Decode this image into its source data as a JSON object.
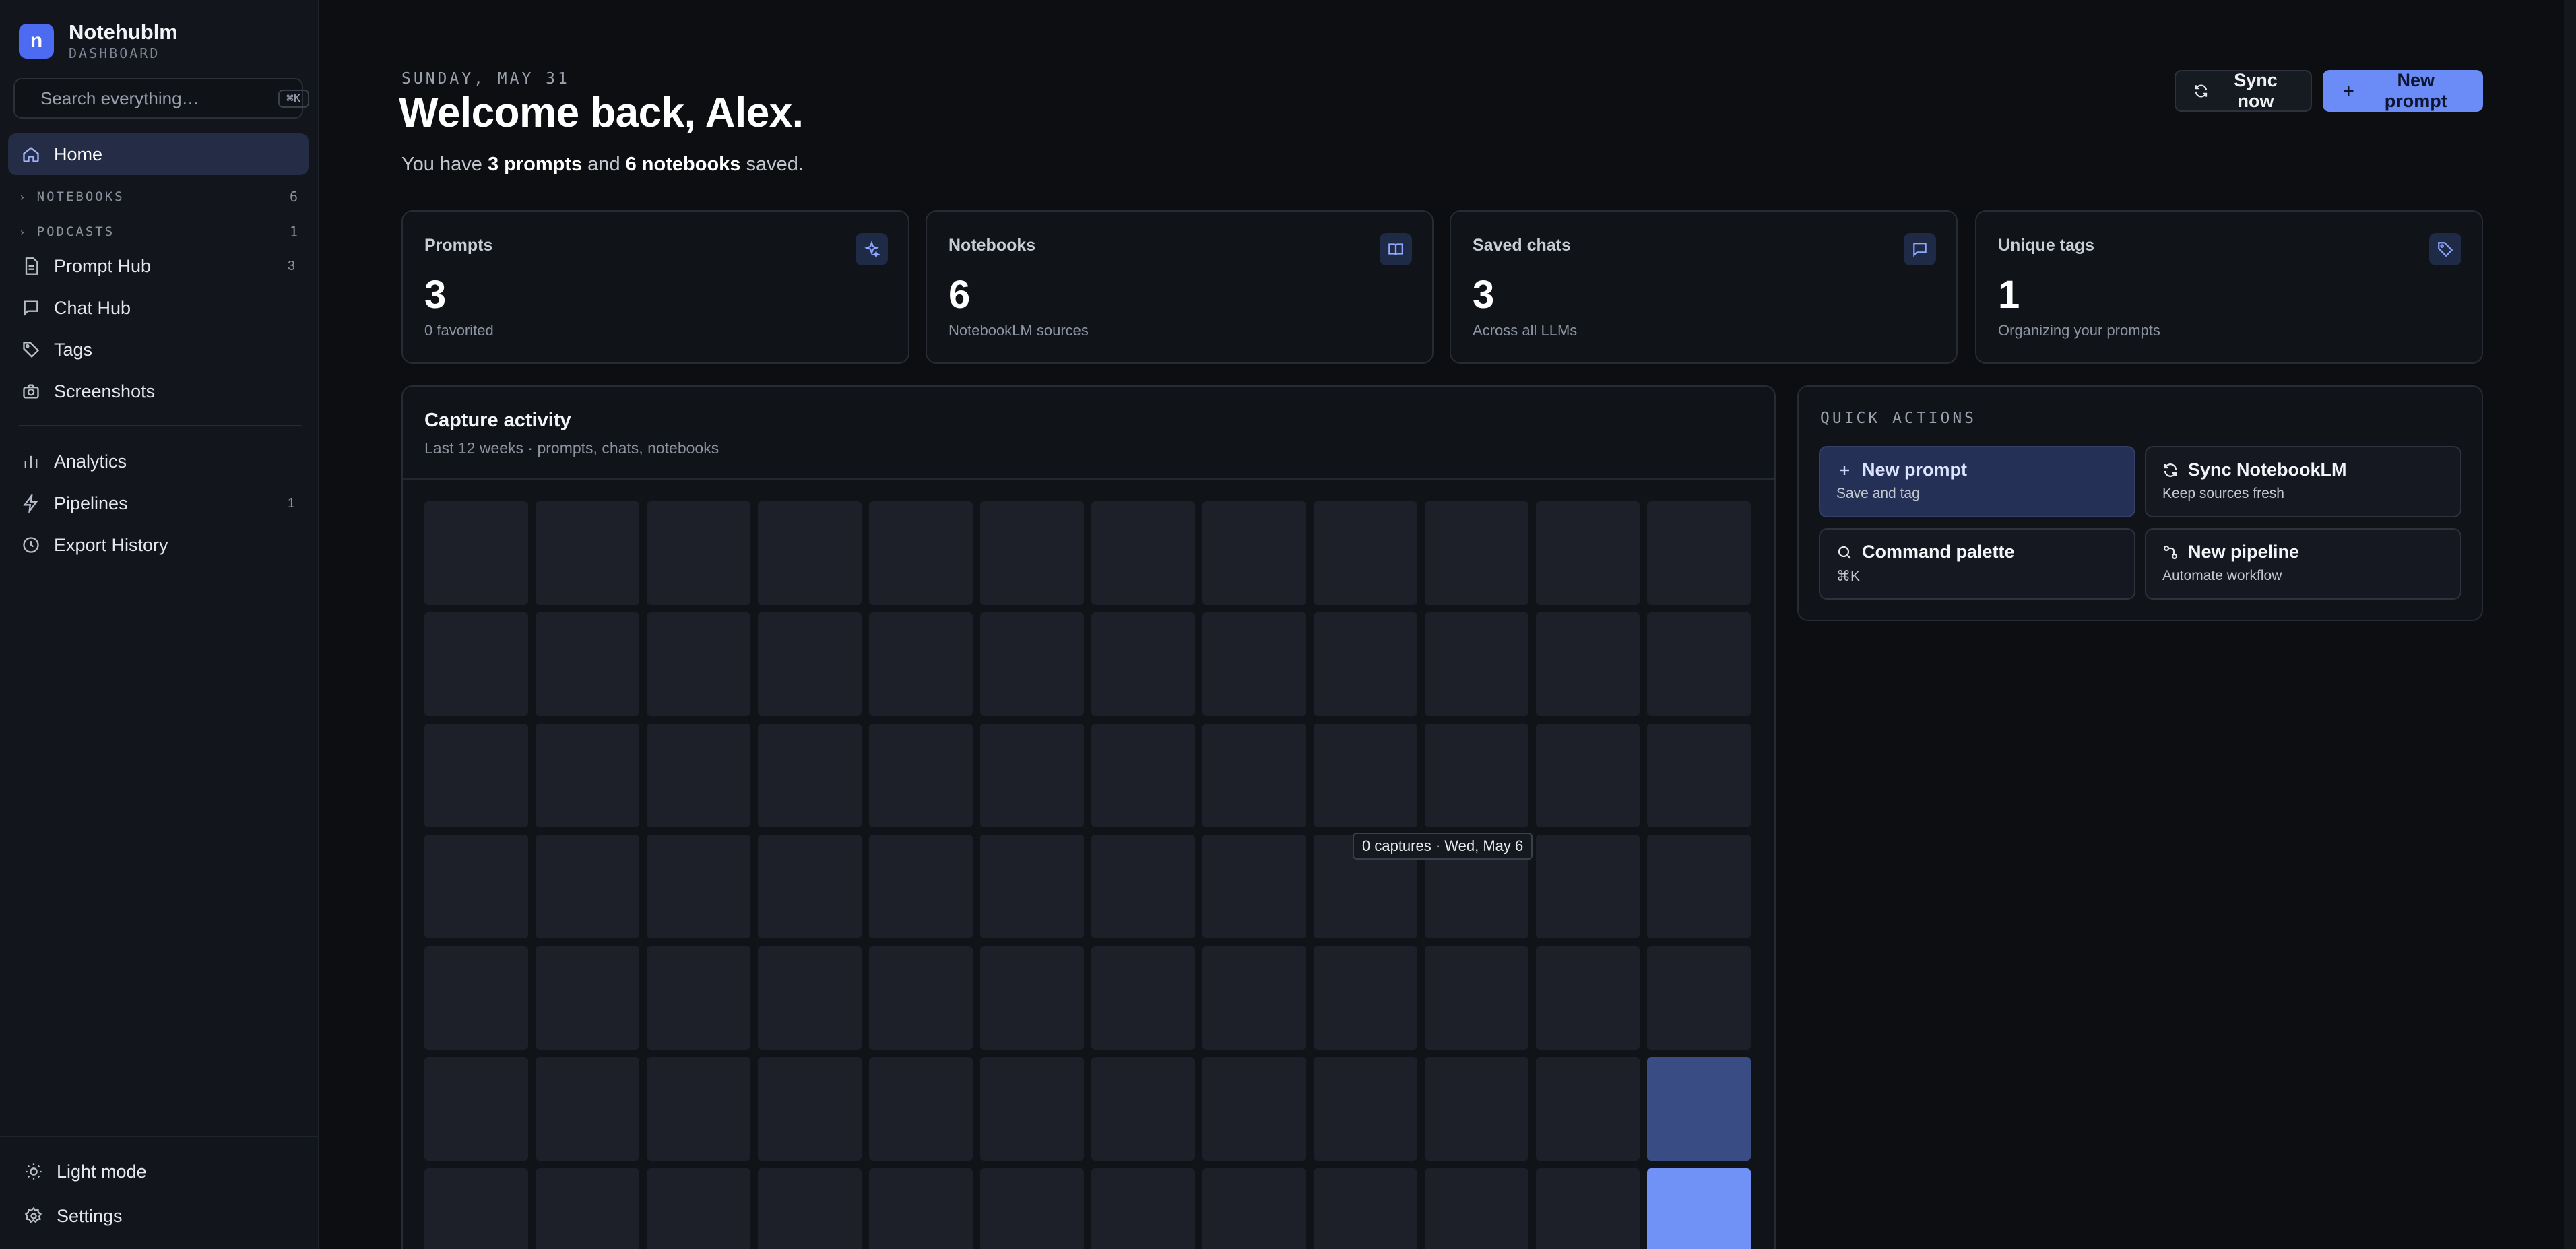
{
  "brand": {
    "logo_letter": "n",
    "title": "Notehublm",
    "subtitle": "DASHBOARD"
  },
  "search": {
    "placeholder": "Search everything…",
    "shortcut": "⌘K"
  },
  "sidebar": {
    "home": {
      "label": "Home",
      "icon": "home-icon"
    },
    "sections": [
      {
        "label": "NOTEBOOKS",
        "count": "6"
      },
      {
        "label": "PODCASTS",
        "count": "1"
      }
    ],
    "items": [
      {
        "label": "Prompt Hub",
        "count": "3",
        "icon": "document-icon"
      },
      {
        "label": "Chat Hub",
        "count": "",
        "icon": "chat-icon"
      },
      {
        "label": "Tags",
        "count": "",
        "icon": "tag-icon"
      },
      {
        "label": "Screenshots",
        "count": "",
        "icon": "camera-icon"
      },
      {
        "label": "Analytics",
        "count": "",
        "icon": "bar-chart-icon"
      },
      {
        "label": "Pipelines",
        "count": "1",
        "icon": "zap-icon"
      },
      {
        "label": "Export History",
        "count": "",
        "icon": "clock-icon"
      }
    ],
    "bottom": [
      {
        "label": "Light mode",
        "icon": "sun-icon"
      },
      {
        "label": "Settings",
        "icon": "gear-icon"
      }
    ]
  },
  "header": {
    "date": "SUNDAY, MAY 31",
    "welcome": "Welcome back, Alex.",
    "summary_prefix": "You have ",
    "prompts_count": "3 prompts",
    "summary_mid": " and ",
    "notebooks_count": "6 notebooks",
    "summary_suffix": " saved.",
    "sync_button": "Sync now",
    "new_prompt_button": "New prompt"
  },
  "stats": [
    {
      "label": "Prompts",
      "value": "3",
      "sub": "0 favorited",
      "icon": "sparkle-icon"
    },
    {
      "label": "Notebooks",
      "value": "6",
      "sub": "NotebookLM sources",
      "icon": "book-icon"
    },
    {
      "label": "Saved chats",
      "value": "3",
      "sub": "Across all LLMs",
      "icon": "chat-icon"
    },
    {
      "label": "Unique tags",
      "value": "1",
      "sub": "Organizing your prompts",
      "icon": "tag-icon"
    }
  ],
  "activity": {
    "title": "Capture activity",
    "subtitle": "Last 12 weeks · prompts, chats, notebooks",
    "tooltip": "0 captures · Wed, May 6",
    "columns": 12,
    "rows_visible": 7,
    "levels": [
      [
        0,
        0,
        0,
        0,
        0,
        0,
        0,
        0,
        0,
        0,
        0,
        0
      ],
      [
        0,
        0,
        0,
        0,
        0,
        0,
        0,
        0,
        0,
        0,
        0,
        0
      ],
      [
        0,
        0,
        0,
        0,
        0,
        0,
        0,
        0,
        0,
        0,
        0,
        0
      ],
      [
        0,
        0,
        0,
        0,
        0,
        0,
        0,
        0,
        0,
        0,
        0,
        0
      ],
      [
        0,
        0,
        0,
        0,
        0,
        0,
        0,
        0,
        0,
        0,
        0,
        0
      ],
      [
        0,
        0,
        0,
        0,
        0,
        0,
        0,
        0,
        0,
        0,
        0,
        1
      ],
      [
        0,
        0,
        0,
        0,
        0,
        0,
        0,
        0,
        0,
        0,
        0,
        2
      ]
    ]
  },
  "quick_actions": {
    "title": "QUICK ACTIONS",
    "items": [
      {
        "title": "New prompt",
        "sub": "Save and tag",
        "icon": "plus-icon"
      },
      {
        "title": "Sync NotebookLM",
        "sub": "Keep sources fresh",
        "icon": "refresh-icon"
      },
      {
        "title": "Command palette",
        "sub": "⌘K",
        "icon": "search-icon"
      },
      {
        "title": "New pipeline",
        "sub": "Automate workflow",
        "icon": "pipeline-icon"
      }
    ]
  },
  "colors": {
    "accent": "#6b8cf7",
    "activity_low": "#3a4c84",
    "activity_high": "#7092f7",
    "background": "#0c0e12"
  }
}
